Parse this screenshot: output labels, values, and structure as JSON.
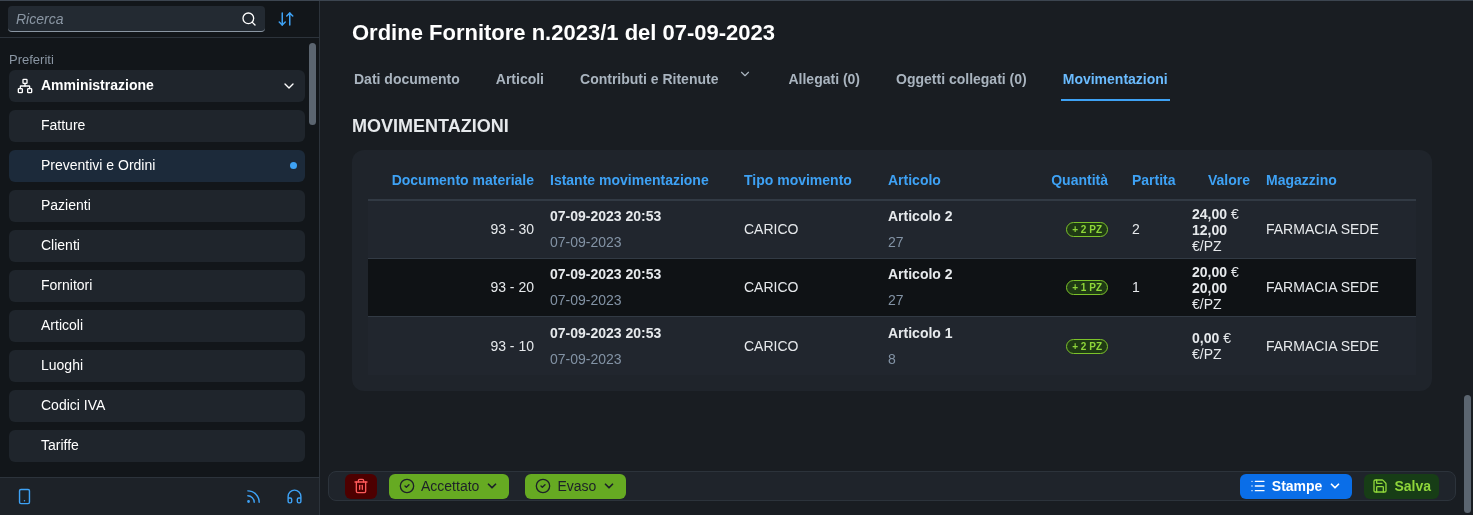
{
  "sidebar": {
    "search": {
      "placeholder": "Ricerca"
    },
    "section_label": "Preferiti",
    "group": {
      "label": "Amministrazione",
      "expanded": true,
      "children": [
        {
          "label": "Fatture",
          "selected": false
        },
        {
          "label": "Preventivi e Ordini",
          "selected": true
        },
        {
          "label": "Pazienti",
          "selected": false
        },
        {
          "label": "Clienti",
          "selected": false
        },
        {
          "label": "Fornitori",
          "selected": false
        },
        {
          "label": "Articoli",
          "selected": false
        },
        {
          "label": "Luoghi",
          "selected": false
        },
        {
          "label": "Codici IVA",
          "selected": false
        },
        {
          "label": "Tariffe",
          "selected": false
        }
      ]
    }
  },
  "header": {
    "title": "Ordine Fornitore n.2023/1 del 07-09-2023"
  },
  "tabs": [
    {
      "label": "Dati documento",
      "selected": false,
      "has_menu": false
    },
    {
      "label": "Articoli",
      "selected": false,
      "has_menu": false
    },
    {
      "label": "Contributi e Ritenute",
      "selected": false,
      "has_menu": true
    },
    {
      "label": "Allegati (0)",
      "selected": false,
      "has_menu": false
    },
    {
      "label": "Oggetti collegati (0)",
      "selected": false,
      "has_menu": false
    },
    {
      "label": "Movimentazioni",
      "selected": true,
      "has_menu": false
    }
  ],
  "section_title": "MOVIMENTAZIONI",
  "table": {
    "columns": [
      "Documento materiale",
      "Istante movimentazione",
      "Tipo movimento",
      "Articolo",
      "Quantità",
      "Partita",
      "Valore",
      "Magazzino"
    ],
    "rows": [
      {
        "documento": "93 - 30",
        "istante": "07-09-2023 20:53",
        "data": "07-09-2023",
        "tipo": "CARICO",
        "articolo": "Articolo 2",
        "codice": "27",
        "quantita": "+ 2 PZ",
        "partita": "2",
        "valore": [
          "**24,00** €",
          "**12,00** €/PZ"
        ],
        "magazzino": "FARMACIA SEDE",
        "selected": false
      },
      {
        "documento": "93 - 20",
        "istante": "07-09-2023 20:53",
        "data": "07-09-2023",
        "tipo": "CARICO",
        "articolo": "Articolo 2",
        "codice": "27",
        "quantita": "+ 1 PZ",
        "partita": "1",
        "valore": [
          "**20,00** €",
          "**20,00** €/PZ"
        ],
        "magazzino": "FARMACIA SEDE",
        "selected": true
      },
      {
        "documento": "93 - 10",
        "istante": "07-09-2023 20:53",
        "data": "07-09-2023",
        "tipo": "CARICO",
        "articolo": "Articolo 1",
        "codice": "8",
        "quantita": "+ 2 PZ",
        "valore": [
          "**0,00** €",
          "€/PZ"
        ],
        "magazzino": "FARMACIA SEDE",
        "selected": false
      }
    ]
  },
  "toolbar": {
    "statuses": [
      {
        "label": "Accettato",
        "checked": true
      },
      {
        "label": "Evaso",
        "checked": true
      }
    ],
    "print_button": "Stampe",
    "save_button": "Salva"
  }
}
